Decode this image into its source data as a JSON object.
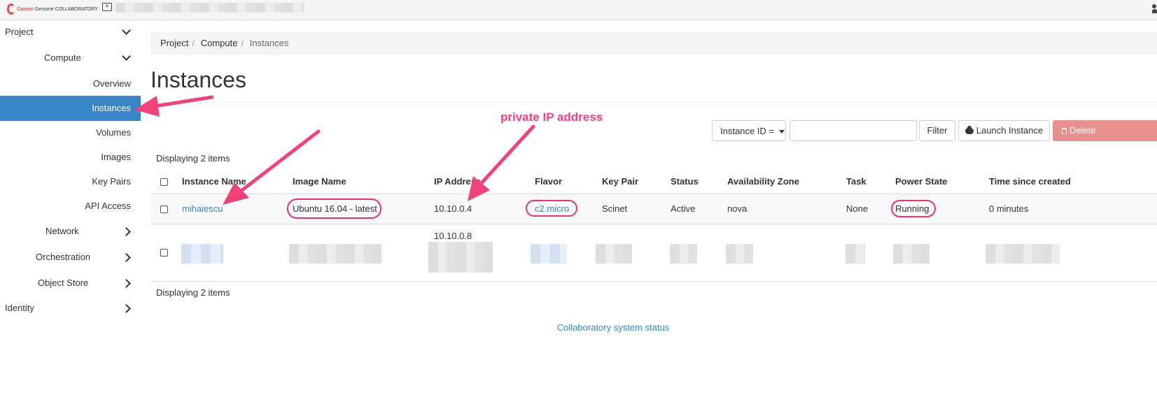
{
  "header": {
    "logo": {
      "word1": "Cancer",
      "word2": "Genome",
      "word3": "COLLABORATORY"
    },
    "project_icon": "project-card-icon",
    "user_icon": "user-icon"
  },
  "sidebar": {
    "project": "Project",
    "compute": "Compute",
    "items": [
      "Overview",
      "Instances",
      "Volumes",
      "Images",
      "Key Pairs",
      "API Access"
    ],
    "active": "Instances",
    "network": "Network",
    "orchestration": "Orchestration",
    "object_store": "Object Store",
    "identity": "Identity"
  },
  "breadcrumb": {
    "project": "Project",
    "compute": "Compute",
    "current": "Instances"
  },
  "page": {
    "title": "Instances"
  },
  "toolbar": {
    "filter_select": "Instance ID =",
    "filter_input_value": "",
    "filter_button": "Filter",
    "launch_button": "Launch Instance",
    "delete_button": "Delete"
  },
  "table": {
    "count_text": "Displaying 2 items",
    "headers": [
      "Instance Name",
      "Image Name",
      "IP Address",
      "Flavor",
      "Key Pair",
      "Status",
      "Availability Zone",
      "Task",
      "Power State",
      "Time since created"
    ],
    "rows": [
      {
        "instance_name": "mihaiescu",
        "image_name": "Ubuntu 16.04 - latest",
        "ip_address": "10.10.0.4",
        "flavor": "c2.micro",
        "key_pair": "Scinet",
        "status": "Active",
        "availability_zone": "nova",
        "task": "None",
        "power_state": "Running",
        "time_since_created": "0 minutes"
      },
      {
        "ip_address": "10.10.0.8"
      }
    ]
  },
  "annotation": {
    "label": "private IP address",
    "color": "#f0437a"
  },
  "footer": {
    "status_link": "Collaboratory system status"
  },
  "colors": {
    "accent": "#3a85c6",
    "delete": "#e8908d",
    "annotation": "#e8326a"
  }
}
